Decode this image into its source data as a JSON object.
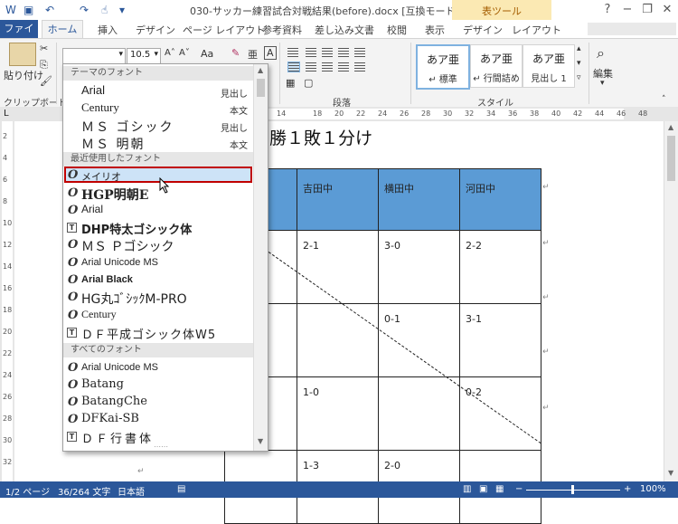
{
  "window": {
    "title": "030-サッカー練習試合対戦結果(before).docx [互換モード] - Word",
    "context_tab_group": "表ツール",
    "minimize": "−",
    "restore": "❐",
    "close": "✕"
  },
  "tabs": [
    "ファイル",
    "ホーム",
    "挿入",
    "デザイン",
    "ページ レイアウト",
    "参考資料",
    "差し込み文書",
    "校閲",
    "表示",
    "デザイン",
    "レイアウト"
  ],
  "ribbon": {
    "clipboard": {
      "paste": "貼り付け",
      "label": "クリップボード"
    },
    "font": {
      "size": "10.5",
      "clear_format": "Aa"
    },
    "paragraph_label": "段落",
    "styles": {
      "items": [
        {
          "sample": "あア亜",
          "name": "↵ 標準"
        },
        {
          "sample": "あア亜",
          "name": "↵ 行間詰め"
        },
        {
          "sample": "あア亜",
          "name": "見出し 1"
        }
      ],
      "label": "スタイル"
    },
    "editing": {
      "label": "編集"
    }
  },
  "ruler_numbers": [
    "14",
    "18",
    "20",
    "22",
    "24",
    "26",
    "28",
    "30",
    "32",
    "34",
    "36",
    "38",
    "40",
    "42",
    "44",
    "46",
    "48"
  ],
  "vruler_numbers": [
    "2",
    "4",
    "6",
    "8",
    "10",
    "12",
    "14",
    "16",
    "18",
    "20",
    "22",
    "24",
    "26",
    "28",
    "30",
    "32"
  ],
  "document": {
    "heading": "勝１敗１分け",
    "table": {
      "header": [
        "",
        "吉田中",
        "横田中",
        "河田中"
      ],
      "rows": [
        [
          "",
          "2-1",
          "3-0",
          "2-2"
        ],
        [
          "",
          "",
          "0-1",
          "3-1"
        ],
        [
          "",
          "1-0",
          "",
          "0-2"
        ],
        [
          "",
          "1-3",
          "2-0",
          ""
        ]
      ]
    },
    "para_mark": "↵"
  },
  "font_dropdown": {
    "theme_header": "テーマのフォント",
    "theme_fonts": [
      {
        "name": "Arial",
        "preview": "見出し"
      },
      {
        "name": "Century",
        "preview": "本文"
      },
      {
        "name": "ＭＳ ゴシック",
        "preview": "見出し"
      },
      {
        "name": "ＭＳ 明朝",
        "preview": "本文"
      }
    ],
    "recent_header": "最近使用したフォント",
    "recent_fonts": [
      {
        "name": "メイリオ",
        "icon": "O"
      },
      {
        "name": "HGP明朝E",
        "icon": "O"
      },
      {
        "name": "Arial",
        "icon": "O"
      },
      {
        "name": "DHP特太ゴシック体",
        "icon": "T"
      },
      {
        "name": "ＭＳ Ｐゴシック",
        "icon": "O"
      },
      {
        "name": "Arial Unicode MS",
        "icon": "O"
      },
      {
        "name": "Arial Black",
        "icon": "O"
      },
      {
        "name": "HG丸ｺﾞｼｯｸM-PRO",
        "icon": "O"
      },
      {
        "name": "Century",
        "icon": "O"
      },
      {
        "name": "ＤＦ平成ゴシック体W5",
        "icon": "T"
      }
    ],
    "all_header": "すべてのフォント",
    "all_fonts": [
      {
        "name": "Arial Unicode MS",
        "icon": "O"
      },
      {
        "name": "Batang",
        "icon": "O"
      },
      {
        "name": "BatangChe",
        "icon": "O"
      },
      {
        "name": "DFKai-SB",
        "icon": "O"
      },
      {
        "name": "ＤＦ行書体",
        "icon": "T"
      }
    ],
    "more": "⋯⋯"
  },
  "statusbar": {
    "page": "1/2 ページ",
    "words": "36/264 文字",
    "language": "日本語",
    "zoom": "100%"
  },
  "colors": {
    "accent": "#2b579a",
    "table_header": "#5b9bd5",
    "highlight_border": "#c00000",
    "context_tab": "#fbe9b3"
  }
}
